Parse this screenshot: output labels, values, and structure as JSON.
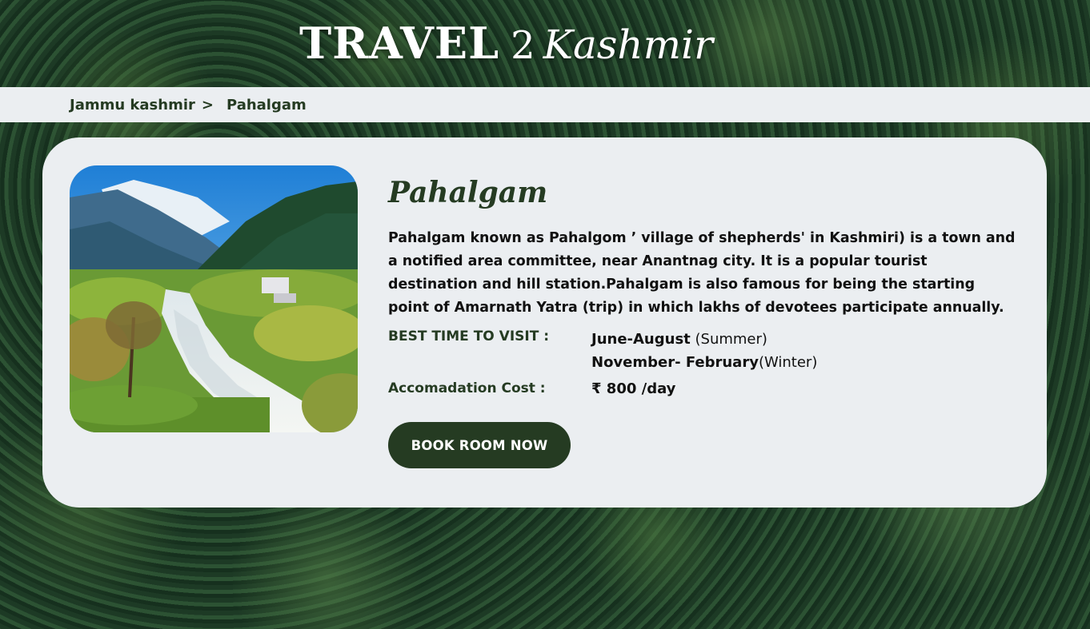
{
  "site": {
    "logo_main": "TRAVEL",
    "logo_num": "2",
    "logo_script": "Kashmir"
  },
  "breadcrumb": {
    "parent": "Jammu kashmir",
    "separator": ">",
    "current": "Pahalgam"
  },
  "destination": {
    "title": "Pahalgam",
    "description": "Pahalgam known as Pahalgom ’ village of shepherds' in Kashmiri) is a town and a notified area committee, near Anantnag city. It is a popular tourist destination and hill station.Pahalgam is also famous for being the starting point of Amarnath Yatra (trip) in which lakhs of devotees participate annually.",
    "best_time_label": "BEST  TIME TO VISIT :",
    "best_time": [
      {
        "months": "June-August",
        "season": " (Summer)"
      },
      {
        "months": "November- February",
        "season": "(Winter)"
      }
    ],
    "cost_label": "Accomadation Cost :",
    "cost_value": "₹ 800 /day",
    "book_button": "BOOK  ROOM NOW"
  },
  "colors": {
    "brand_dark_green": "#253b22",
    "panel_bg": "#ebeef1"
  }
}
